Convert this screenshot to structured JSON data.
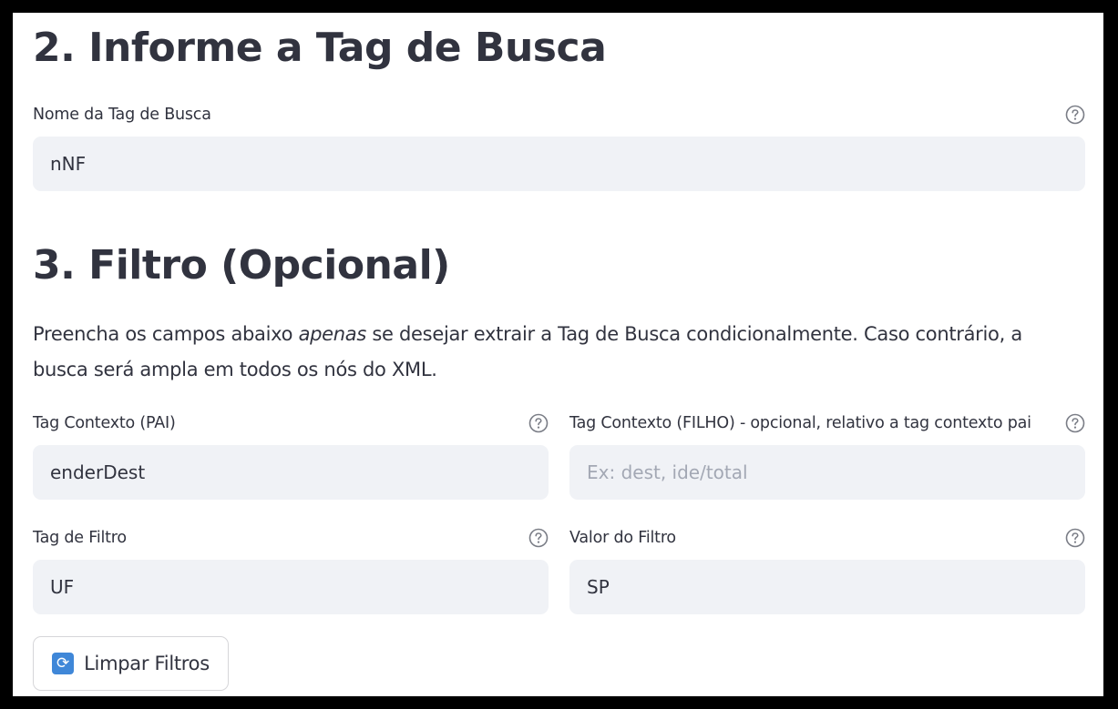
{
  "section_tag": {
    "heading": "2. Informe a Tag de Busca",
    "field_label": "Nome da Tag de Busca",
    "field_value": "nNF"
  },
  "section_filtro": {
    "heading": "3. Filtro (Opcional)",
    "desc_before": "Preencha os campos abaixo ",
    "desc_em": "apenas",
    "desc_after": " se desejar extrair a Tag de Busca condicionalmente. Caso contrário, a busca será ampla em todos os nós do XML.",
    "fields": {
      "contexto_pai": {
        "label": "Tag Contexto (PAI)",
        "value": "enderDest"
      },
      "contexto_filho": {
        "label": "Tag Contexto (FILHO) - opcional, relativo a tag contexto pai",
        "value": "",
        "placeholder": "Ex: dest, ide/total"
      },
      "tag_filtro": {
        "label": "Tag de Filtro",
        "value": "UF"
      },
      "valor_filtro": {
        "label": "Valor do Filtro",
        "value": "SP"
      }
    },
    "clear_button": {
      "icon": "refresh-icon",
      "label": "Limpar Filtros"
    }
  },
  "colors": {
    "text": "#31333f",
    "input_bg": "#f0f2f6",
    "placeholder": "#a3a8b4",
    "help_icon": "#7a7d86",
    "refresh_icon_bg": "#3f87d8"
  }
}
